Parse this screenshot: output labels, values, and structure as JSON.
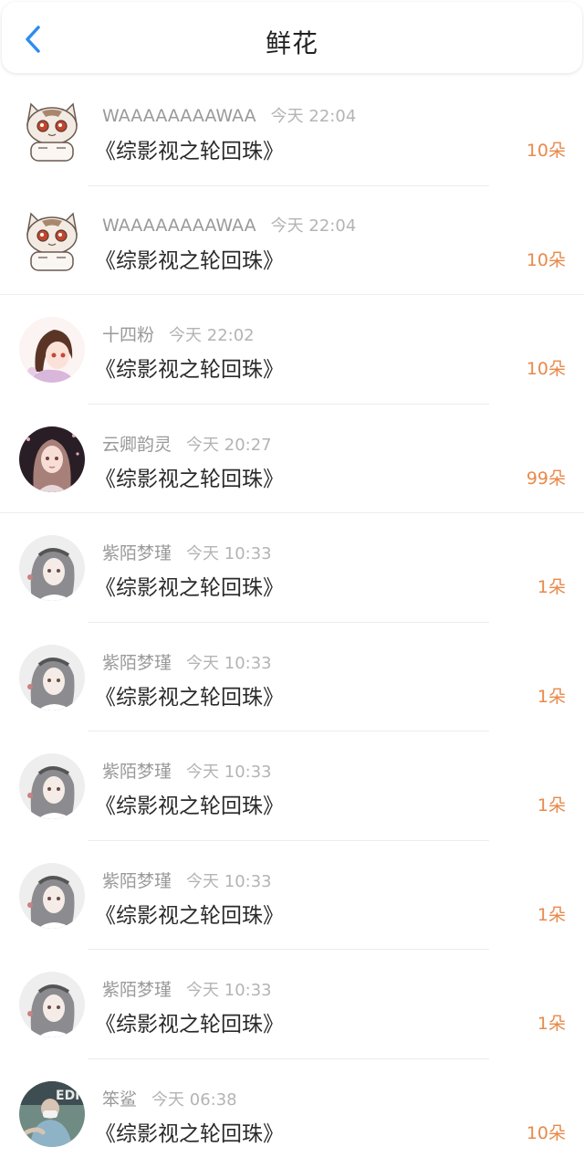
{
  "header": {
    "title": "鲜花",
    "back_icon": "chevron-left-icon",
    "accent": "#2d8cf0"
  },
  "colors": {
    "amount": "#e8894a",
    "name": "#9a9a9a",
    "book": "#2a2a2a"
  },
  "items": [
    {
      "name": "WAAAAAAAAWAA",
      "time": "今天 22:04",
      "book": "《综影视之轮回珠》",
      "amount": "10朵",
      "avatar": "cat-avatar-icon"
    },
    {
      "name": "WAAAAAAAAWAA",
      "time": "今天 22:04",
      "book": "《综影视之轮回珠》",
      "amount": "10朵",
      "avatar": "cat-avatar-icon"
    },
    {
      "name": "十四粉",
      "time": "今天 22:02",
      "book": "《综影视之轮回珠》",
      "amount": "10朵",
      "avatar": "anime-girl-avatar-icon"
    },
    {
      "name": "云卿韵灵",
      "time": "今天 20:27",
      "book": "《综影视之轮回珠》",
      "amount": "99朵",
      "avatar": "anime-girl-avatar-icon"
    },
    {
      "name": "紫陌梦瑾",
      "time": "今天 10:33",
      "book": "《综影视之轮回珠》",
      "amount": "1朵",
      "avatar": "anime-girl-avatar-icon"
    },
    {
      "name": "紫陌梦瑾",
      "time": "今天 10:33",
      "book": "《综影视之轮回珠》",
      "amount": "1朵",
      "avatar": "anime-girl-avatar-icon"
    },
    {
      "name": "紫陌梦瑾",
      "time": "今天 10:33",
      "book": "《综影视之轮回珠》",
      "amount": "1朵",
      "avatar": "anime-girl-avatar-icon"
    },
    {
      "name": "紫陌梦瑾",
      "time": "今天 10:33",
      "book": "《综影视之轮回珠》",
      "amount": "1朵",
      "avatar": "anime-girl-avatar-icon"
    },
    {
      "name": "紫陌梦瑾",
      "time": "今天 10:33",
      "book": "《综影视之轮回珠》",
      "amount": "1朵",
      "avatar": "anime-girl-avatar-icon"
    },
    {
      "name": "笨鲨",
      "time": "今天 06:38",
      "book": "《综影视之轮回珠》",
      "amount": "10朵",
      "avatar": "photo-avatar-icon"
    }
  ]
}
